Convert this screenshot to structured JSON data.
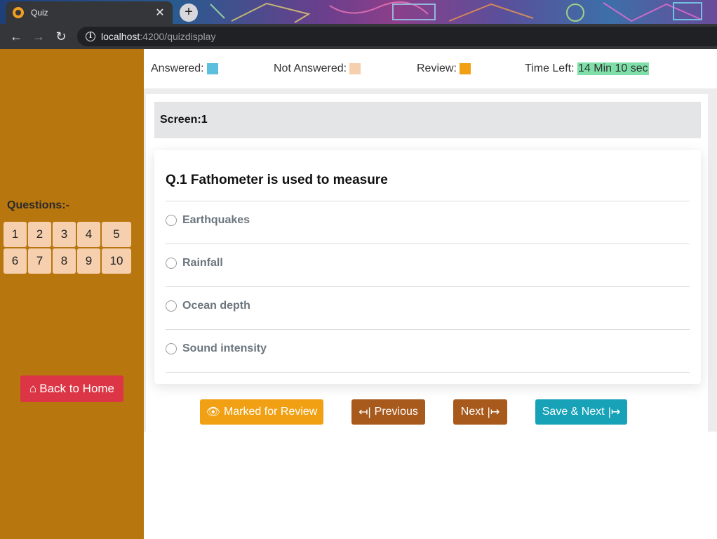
{
  "browser": {
    "tab_title": "Quiz",
    "tab_close": "✕",
    "new_tab": "+",
    "url_host": "localhost",
    "url_rest": ":4200/quizdisplay",
    "back_icon": "←",
    "forward_icon": "→",
    "reload_icon": "↻"
  },
  "legend": {
    "answered_label": "Answered:",
    "answered_color": "#5bc0de",
    "not_answered_label": "Not Answered:",
    "not_answered_color": "#f5cfae",
    "review_label": "Review:",
    "review_color": "#f0a012",
    "time_label": "Time Left:",
    "time_value": "14 Min 10 sec"
  },
  "sidebar": {
    "questions_label": "Questions:-",
    "question_numbers": [
      "1",
      "2",
      "3",
      "4",
      "5",
      "6",
      "7",
      "8",
      "9",
      "10"
    ],
    "home_icon": "⌂",
    "home_label": "Back to Home"
  },
  "quiz": {
    "screen_label": "Screen:1",
    "question": "Q.1 Fathometer is used to measure",
    "options": [
      "Earthquakes",
      "Rainfall",
      "Ocean depth",
      "Sound intensity"
    ]
  },
  "buttons": {
    "review_icon": "👁",
    "review_label": "Marked for Review",
    "prev_icon": "↤|",
    "prev_label": "Previous",
    "next_label": "Next",
    "next_icon": "|↦",
    "save_label": "Save & Next",
    "save_icon": "|↦"
  }
}
